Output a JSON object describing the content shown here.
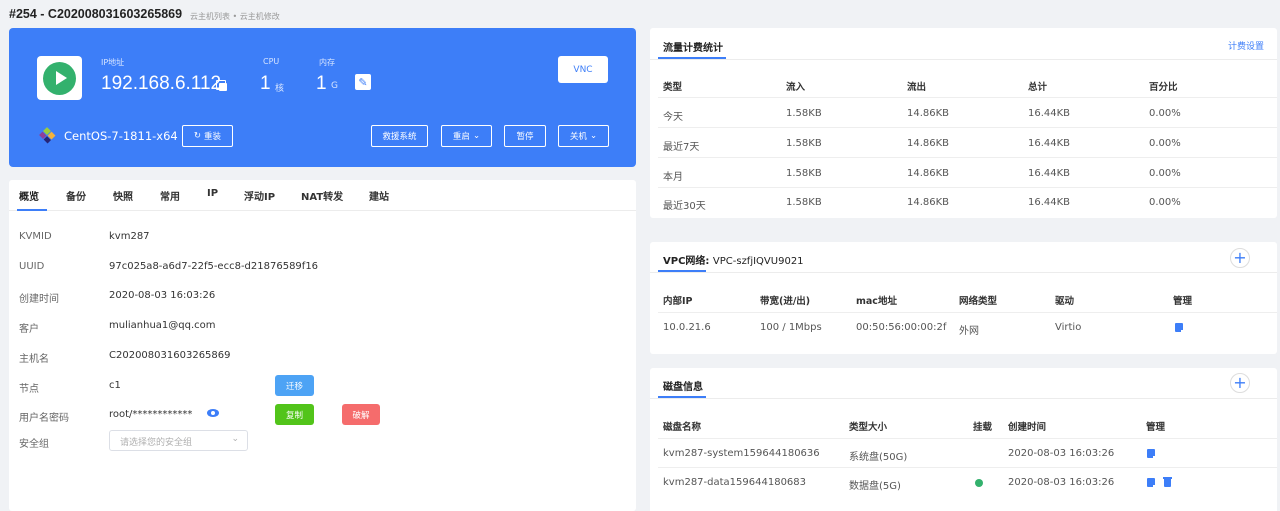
{
  "header": {
    "title": "#254 - C202008031603265869",
    "breadcrumb": "云主机列表 • 云主机修改"
  },
  "server": {
    "ip_label": "IP地址",
    "ip": "192.168.6.112",
    "cpu_label": "CPU",
    "cpu_value": "1",
    "cpu_unit": "核",
    "mem_label": "内存",
    "mem_value": "1",
    "mem_unit": "G",
    "vnc_label": "VNC",
    "os_name": "CentOS-7-1811-x64",
    "reinstall_label": "重装",
    "actions": {
      "rescue": "救援系统",
      "restart": "重启",
      "pause": "暂停",
      "shutdown": "关机"
    }
  },
  "tabs": [
    "概览",
    "备份",
    "快照",
    "常用",
    "IP",
    "浮动IP",
    "NAT转发",
    "建站"
  ],
  "overview": {
    "rows": [
      {
        "label": "KVMID",
        "value": "kvm287"
      },
      {
        "label": "UUID",
        "value": "97c025a8-a6d7-22f5-ecc8-d21876589f16"
      },
      {
        "label": "创建时间",
        "value": "2020-08-03 16:03:26"
      },
      {
        "label": "客户",
        "value": "mulianhua1@qq.com"
      },
      {
        "label": "主机名",
        "value": "C202008031603265869"
      },
      {
        "label": "节点",
        "value": "c1"
      },
      {
        "label": "用户名密码",
        "value": "root/************"
      },
      {
        "label": "安全组",
        "value": ""
      }
    ],
    "migrate_label": "迁移",
    "copy_label": "复制",
    "crack_label": "破解",
    "security_placeholder": "请选择您的安全组"
  },
  "traffic": {
    "title": "流量计费统计",
    "settings_link": "计费设置",
    "headers": [
      "类型",
      "流入",
      "流出",
      "总计",
      "百分比"
    ],
    "rows": [
      [
        "今天",
        "1.58KB",
        "14.86KB",
        "16.44KB",
        "0.00%"
      ],
      [
        "最近7天",
        "1.58KB",
        "14.86KB",
        "16.44KB",
        "0.00%"
      ],
      [
        "本月",
        "1.58KB",
        "14.86KB",
        "16.44KB",
        "0.00%"
      ],
      [
        "最近30天",
        "1.58KB",
        "14.86KB",
        "16.44KB",
        "0.00%"
      ]
    ]
  },
  "vpc": {
    "title": "VPC网络:",
    "name": "VPC-szfjIQVU9021",
    "headers": [
      "内部IP",
      "带宽(进/出)",
      "mac地址",
      "网络类型",
      "驱动",
      "管理"
    ],
    "row": [
      "10.0.21.6",
      "100 / 1Mbps",
      "00:50:56:00:00:2f",
      "外网",
      "Virtio"
    ]
  },
  "disk": {
    "title": "磁盘信息",
    "headers": [
      "磁盘名称",
      "类型大小",
      "挂载",
      "创建时间",
      "管理"
    ],
    "rows": [
      [
        "kvm287-system159644180636",
        "系统盘(50G)",
        "",
        "2020-08-03 16:03:26"
      ],
      [
        "kvm287-data159644180683",
        "数据盘(5G)",
        "",
        "2020-08-03 16:03:26"
      ]
    ]
  },
  "colors": {
    "primary": "#3d7ef8",
    "success": "#33b16d",
    "danger": "#f56c6c",
    "copy": "#52c41a"
  }
}
